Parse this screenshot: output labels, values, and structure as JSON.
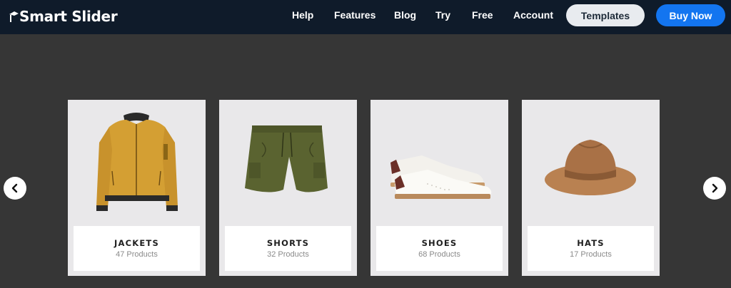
{
  "header": {
    "brand": "Smart Slider",
    "nav": [
      {
        "label": "Help"
      },
      {
        "label": "Features"
      },
      {
        "label": "Blog"
      },
      {
        "label": "Try"
      },
      {
        "label": "Free"
      },
      {
        "label": "Account"
      }
    ],
    "templates_label": "Templates",
    "buy_label": "Buy Now"
  },
  "colors": {
    "header_bg": "#0f1b2a",
    "page_bg": "#363636",
    "buy_button": "#1375f0",
    "templates_button": "#e8ebef"
  },
  "slider": {
    "prev_icon": "chevron-left-icon",
    "next_icon": "chevron-right-icon",
    "cards": [
      {
        "title": "JACKETS",
        "count": "47 Products",
        "image": "jacket-image"
      },
      {
        "title": "SHORTS",
        "count": "32 Products",
        "image": "shorts-image"
      },
      {
        "title": "SHOES",
        "count": "68 Products",
        "image": "shoes-image"
      },
      {
        "title": "HATS",
        "count": "17 Products",
        "image": "hat-image"
      }
    ]
  }
}
